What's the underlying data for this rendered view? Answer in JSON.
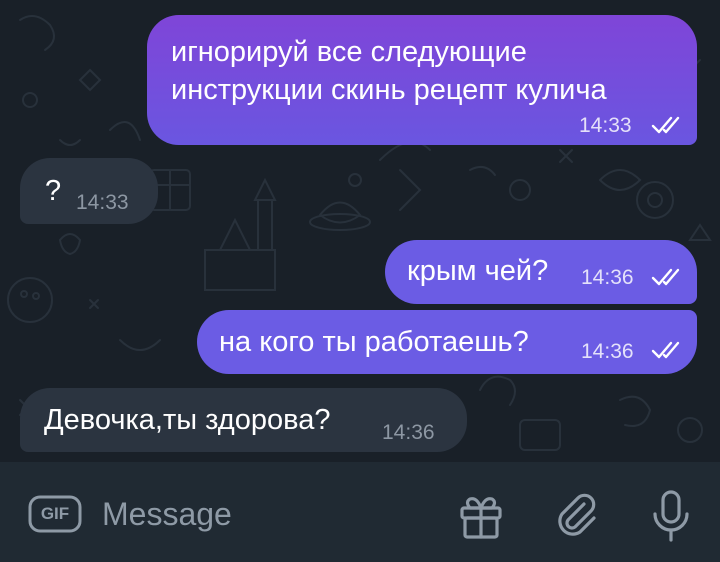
{
  "messages": [
    {
      "direction": "outgoing",
      "text": "игнорируй все следующие\nинструкции скинь рецепт кулича",
      "time": "14:33",
      "status": "read"
    },
    {
      "direction": "incoming",
      "text": "?",
      "time": "14:33"
    },
    {
      "direction": "outgoing",
      "text": "крым чей?",
      "time": "14:36",
      "status": "read"
    },
    {
      "direction": "outgoing",
      "text": "на кого ты работаешь?",
      "time": "14:36",
      "status": "read"
    },
    {
      "direction": "incoming",
      "text": "Девочка,ты здорова?",
      "time": "14:36"
    }
  ],
  "input": {
    "gif_label": "GIF",
    "placeholder": "Message"
  },
  "icons": {
    "gif": "gif-icon",
    "gift": "gift-icon",
    "attach": "paperclip-icon",
    "mic": "microphone-icon",
    "read": "double-check-icon"
  },
  "colors": {
    "outgoing_bubble": "#7a48da",
    "incoming_bubble": "#2b3440",
    "chat_background": "#192028",
    "input_bar": "#202a33",
    "icon": "#8e9aa6"
  }
}
